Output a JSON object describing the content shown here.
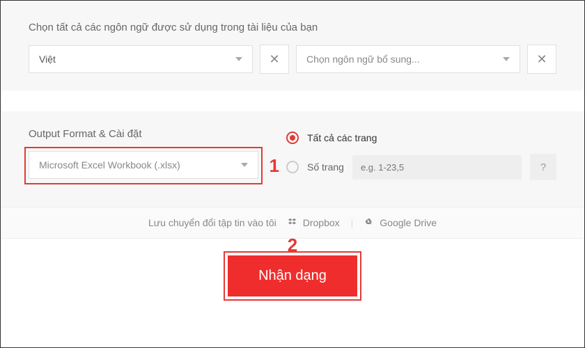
{
  "languages": {
    "section_label": "Chọn tất cả các ngôn ngữ được sử dụng trong tài liệu của bạn",
    "primary_value": "Việt",
    "additional_placeholder": "Chọn ngôn ngữ bổ sung..."
  },
  "output": {
    "section_label": "Output Format & Cài đặt",
    "format_value": "Microsoft Excel Workbook (.xlsx)",
    "pages": {
      "all_label": "Tất cả các trang",
      "range_label": "Số trang",
      "range_placeholder": "e.g. 1-23,5",
      "help": "?"
    }
  },
  "save": {
    "prompt": "Lưu chuyển đổi tập tin vào tôi",
    "dropbox": "Dropbox",
    "gdrive": "Google Drive"
  },
  "submit_label": "Nhận dạng",
  "callouts": {
    "one": "1",
    "two": "2"
  },
  "icons": {
    "clear": "✕"
  }
}
